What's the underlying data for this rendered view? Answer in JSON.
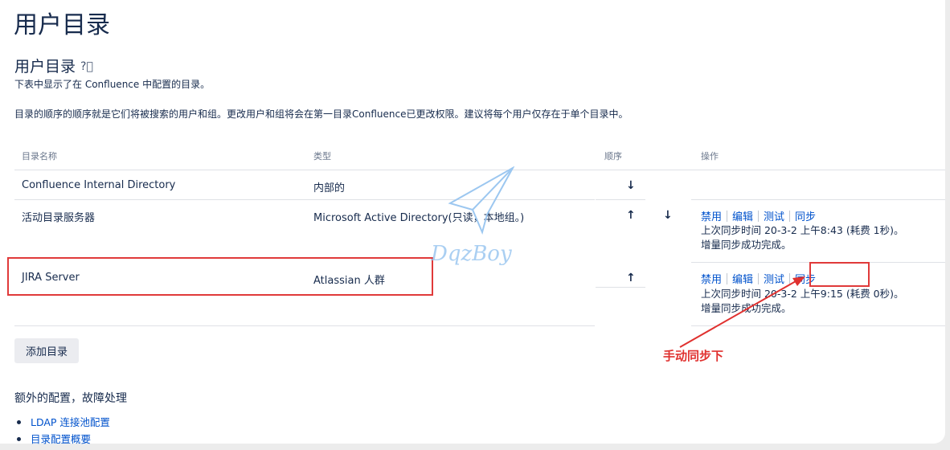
{
  "page": {
    "title": "用户目录"
  },
  "section": {
    "title": "用户目录",
    "help_icon": "help-circle-icon",
    "description": "下表中显示了在 Confluence 中配置的目录。",
    "order_note": "目录的顺序的顺序就是它们将被搜索的用户和组。更改用户和组将会在第一目录Confluence已更改权限。建议将每个用户仅存在于单个目录中。"
  },
  "table": {
    "headers": {
      "name": "目录名称",
      "type": "类型",
      "order": "顺序",
      "ops": "操作"
    },
    "rows": [
      {
        "name": "Confluence Internal Directory",
        "type": "内部的",
        "arrows": [
          "↓"
        ]
      },
      {
        "name": "活动目录服务器",
        "type": "Microsoft Active Directory(只读，本地组。)",
        "arrows": [
          "↑",
          "↓"
        ],
        "actions": [
          "禁用",
          "编辑",
          "测试",
          "同步"
        ],
        "sync_time": "上次同步时间 20-3-2 上午8:43 (耗费 1秒)。",
        "sync_status": "增量同步成功完成。"
      },
      {
        "name": "JIRA Server",
        "type": "Atlassian 人群",
        "arrows": [
          "↑"
        ],
        "actions": [
          "禁用",
          "编辑",
          "测试",
          "同步"
        ],
        "sync_time": "上次同步时间 20-3-2 上午9:15 (耗费 0秒)。",
        "sync_status": "增量同步成功完成。"
      }
    ]
  },
  "add_button": {
    "label": "添加目录"
  },
  "extra": {
    "title": "额外的配置，故障处理",
    "links": [
      "LDAP 连接池配置",
      "目录配置概要"
    ]
  },
  "annotation": {
    "text": "手动同步下",
    "color": "#e0312f"
  },
  "watermark": {
    "text": "DqzBoy",
    "icon": "paper-plane-icon"
  }
}
